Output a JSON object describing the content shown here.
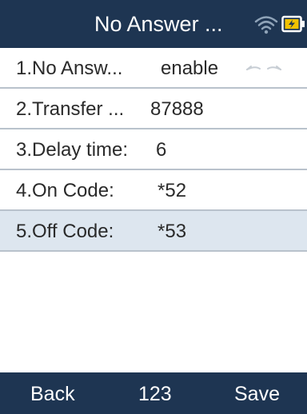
{
  "header": {
    "title": "No Answer ...",
    "wifi_icon": "wifi-icon",
    "battery_icon": "battery-charging-icon"
  },
  "menu": {
    "items": [
      {
        "label": "1.No Answ...",
        "value": "enable"
      },
      {
        "label": "2.Transfer ...",
        "value": "87888"
      },
      {
        "label": "3.Delay time:",
        "value": "6"
      },
      {
        "label": "4.On Code:",
        "value": "*52"
      },
      {
        "label": "5.Off Code:",
        "value": "*53"
      }
    ],
    "selected_index": 4,
    "toggle_icon": "left-right-arrows-icon"
  },
  "softkeys": {
    "left": "Back",
    "center": "123",
    "right": "Save"
  },
  "colors": {
    "bar": "#1e3552",
    "selected_row": "#dde6ef",
    "divider": "#b9c2cc"
  }
}
